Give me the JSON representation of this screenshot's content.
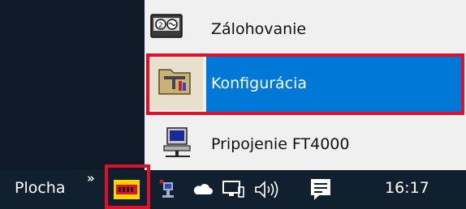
{
  "menu": {
    "items": [
      {
        "label": "Zálohovanie",
        "icon": "backup-tape-icon"
      },
      {
        "label": "Konfigurácia",
        "icon": "config-tools-folder-icon",
        "selected": true
      },
      {
        "label": "Pripojenie FT4000",
        "icon": "network-computer-icon"
      }
    ]
  },
  "taskbar": {
    "desktop_label": "Plocha",
    "overflow_chevron": "»",
    "tray_icons": [
      "app-tray-icon",
      "network-computer-tray-icon",
      "cloud-icon",
      "network-icon",
      "volume-icon",
      "action-center-icon"
    ],
    "clock": "16:17"
  },
  "colors": {
    "highlight": "#0078d7",
    "outline": "#e0102a",
    "taskbar": "#10202f"
  }
}
